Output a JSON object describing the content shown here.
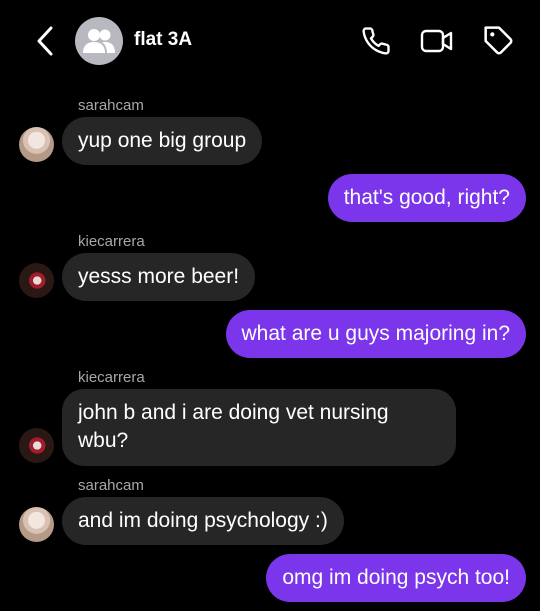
{
  "header": {
    "title": "flat 3A",
    "icons": {
      "back": "chevron-left-icon",
      "group": "group-avatar-icon",
      "call": "phone-icon",
      "video": "video-camera-icon",
      "tag": "tag-icon"
    }
  },
  "colors": {
    "background": "#000000",
    "incoming_bubble": "#262626",
    "outgoing_bubble": "#7b35ea",
    "sender_name": "#a8a8a8"
  },
  "messages": [
    {
      "direction": "in",
      "sender": "sarahcam",
      "text": "yup one big group"
    },
    {
      "direction": "out",
      "text": "that's good, right?"
    },
    {
      "direction": "in",
      "sender": "kiecarrera",
      "text": "yesss more beer!"
    },
    {
      "direction": "out",
      "text": "what are u guys majoring in?"
    },
    {
      "direction": "in",
      "sender": "kiecarrera",
      "text_line1": "john b and i are doing vet nursing",
      "text_line2": "wbu?"
    },
    {
      "direction": "in",
      "sender": "sarahcam",
      "text": "and im doing psychology :)"
    },
    {
      "direction": "out",
      "text": "omg im doing psych too!"
    }
  ]
}
